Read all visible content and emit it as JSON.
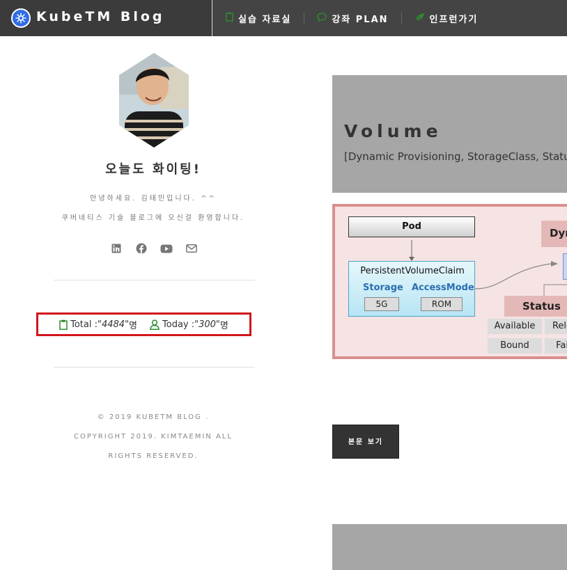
{
  "header": {
    "brand": "KubeTM Blog",
    "nav": [
      {
        "label": "실습 자료실",
        "icon": "clipboard-icon"
      },
      {
        "label": "강좌 PLAN",
        "icon": "chat-icon"
      },
      {
        "label": "인프런가기",
        "icon": "leaf-icon"
      }
    ],
    "colors": {
      "bar": "#444444",
      "brand_bg": "#3b3b3b",
      "logo": "#326ce5"
    }
  },
  "sidebar": {
    "greeting": "오늘도 화이팅!",
    "intro_line1": "안녕하세요. 김태민입니다. ^^",
    "intro_line2": "쿠버네티스 기술 블로그에 오신걸 환영합니다.",
    "socials": [
      "linkedin-icon",
      "facebook-icon",
      "youtube-icon",
      "mail-icon"
    ],
    "counter": {
      "total_label": "Total : ",
      "total_value": "\"4484\"",
      "today_label": "Today : ",
      "today_value": "\"300\"",
      "unit": "명",
      "highlight_color": "#d0161b",
      "icon_color": "#2e8b2e"
    },
    "footer": {
      "line1": "© 2019 KUBETM BLOG .",
      "line2": "COPYRIGHT 2019. KIMTAEMIN ALL",
      "line3": "RIGHTS RESERVED."
    }
  },
  "post": {
    "title": "Volume",
    "subtitle": "[Dynamic Provisioning, StorageClass, Status",
    "diagram": {
      "pod": "Pod",
      "pvc_title": "PersistentVolumeClaim",
      "storage_label": "Storage",
      "storage_value": "5G",
      "access_label": "AccessMode",
      "access_value": "ROM",
      "dyn": "Dyn",
      "status": "Status",
      "status_items": [
        "Available",
        "Rele",
        "Bound",
        "Fai"
      ]
    },
    "read_more": "본문 보기"
  }
}
